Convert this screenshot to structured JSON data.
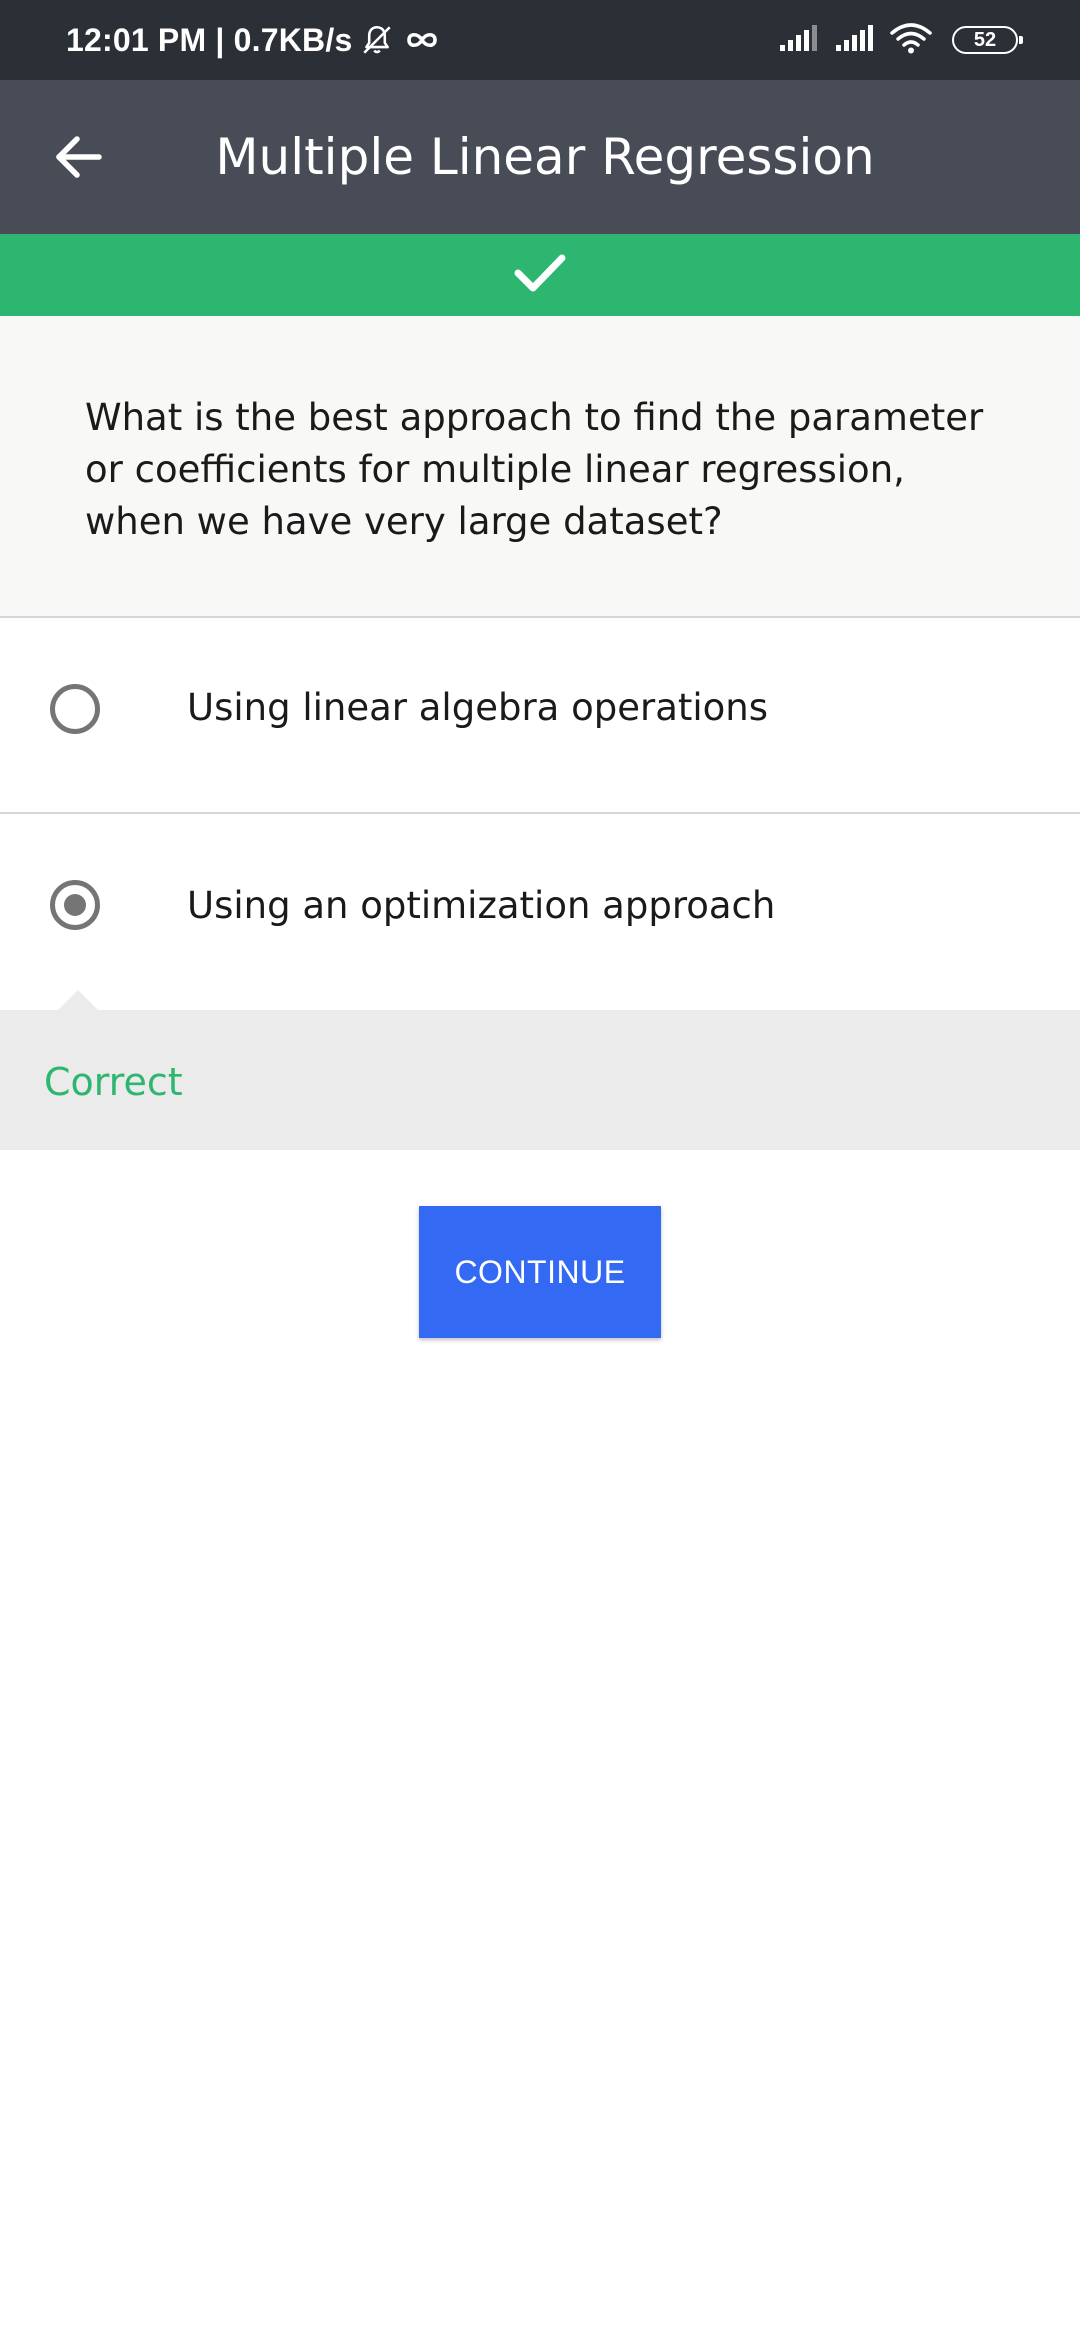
{
  "status_bar": {
    "time_speed": "12:01 PM | 0.7KB/s",
    "mute_icon": "bell-off-icon",
    "infinity_icon": "infinity-icon",
    "signal_icons": [
      "signal-icon",
      "signal-icon"
    ],
    "wifi_icon": "wifi-icon",
    "battery": "52"
  },
  "app_bar": {
    "back_icon": "arrow-left-icon",
    "title": "Multiple Linear Regression"
  },
  "banner": {
    "icon": "checkmark-icon",
    "color": "#2cb670"
  },
  "question": {
    "text": "What is the best approach to find the parameter or coefficients for multiple linear regression, when we have very large dataset?"
  },
  "options": [
    {
      "label": "Using linear algebra operations",
      "selected": false
    },
    {
      "label": "Using an optimization approach",
      "selected": true
    }
  ],
  "feedback": {
    "text": "Correct",
    "color": "#2cb670"
  },
  "continue_button": {
    "label": "CONTINUE",
    "color": "#3369f3"
  }
}
